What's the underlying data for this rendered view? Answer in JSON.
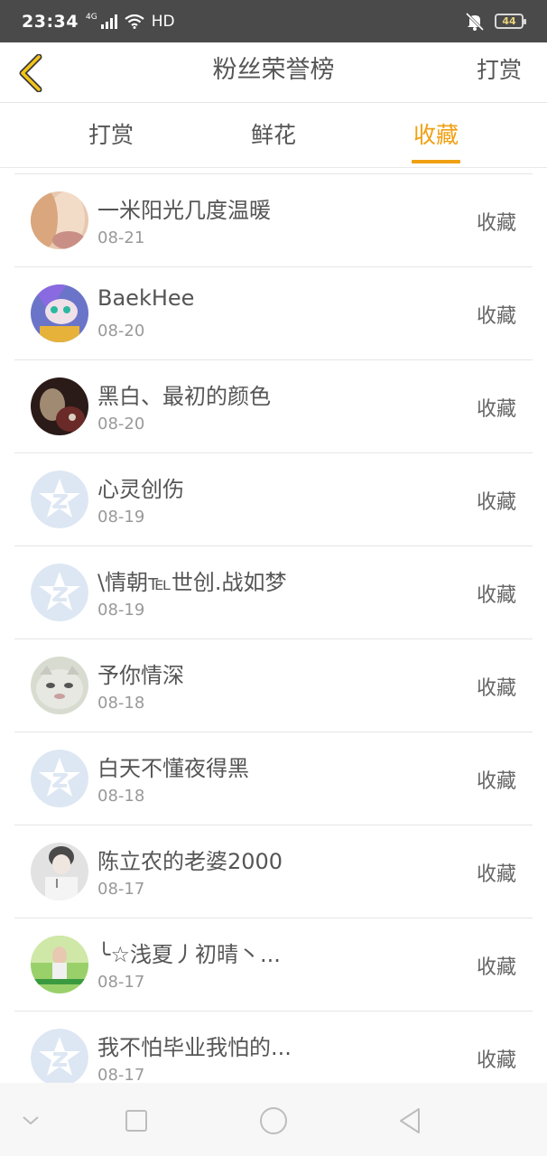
{
  "status_bar": {
    "time": "23:34",
    "network_small": "4G",
    "hd": "HD",
    "battery": "44"
  },
  "header": {
    "title": "粉丝荣誉榜",
    "action_label": "打赏"
  },
  "tabs": [
    {
      "label": "打赏",
      "active": false
    },
    {
      "label": "鲜花",
      "active": false
    },
    {
      "label": "收藏",
      "active": true
    }
  ],
  "colors": {
    "accent": "#f0a012",
    "status_bar": "#4a4a4a",
    "text": "#555555",
    "subtext": "#999999"
  },
  "list": [
    {
      "name": "一米阳光几度温暖",
      "date": "08-21",
      "type": "收藏",
      "avatar": "photo-blonde"
    },
    {
      "name": "BaekHee",
      "date": "08-20",
      "type": "收藏",
      "avatar": "anime"
    },
    {
      "name": "黑白、最初的颜色",
      "date": "08-20",
      "type": "收藏",
      "avatar": "dark-photo"
    },
    {
      "name": "心灵创伤",
      "date": "08-19",
      "type": "收藏",
      "avatar": "default-z"
    },
    {
      "name": "\\情朝℡世创.战如梦",
      "date": "08-19",
      "type": "收藏",
      "avatar": "default-z"
    },
    {
      "name": "予你情深",
      "date": "08-18",
      "type": "收藏",
      "avatar": "cat"
    },
    {
      "name": "白天不懂夜得黑",
      "date": "08-18",
      "type": "收藏",
      "avatar": "default-z"
    },
    {
      "name": "陈立农的老婆2000",
      "date": "08-17",
      "type": "收藏",
      "avatar": "gray-photo"
    },
    {
      "name": "╰☆浅夏丿初晴丶...",
      "date": "08-17",
      "type": "收藏",
      "avatar": "green-photo"
    },
    {
      "name": "我不怕毕业我怕的...",
      "date": "08-17",
      "type": "收藏",
      "avatar": "default-z"
    }
  ]
}
